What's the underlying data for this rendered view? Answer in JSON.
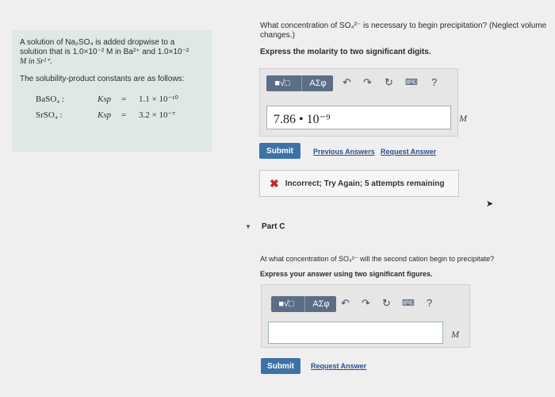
{
  "problem": {
    "intro_1": "A solution of Na₂SO₄ is added dropwise to a",
    "intro_2": "solution that is 1.0×10⁻² M in Ba²⁺ and 1.0×10⁻²",
    "intro_3": "M in Sr²⁺.",
    "ksp_title": "The solubility-product constants are as follows:",
    "ksp_rows": [
      {
        "compound": "BaSO₄ :",
        "symbol": "Ksp",
        "eq": "=",
        "value": "1.1 × 10⁻¹⁰"
      },
      {
        "compound": "SrSO₄ :",
        "symbol": "Ksp",
        "eq": "=",
        "value": "3.2 × 10⁻⁷"
      }
    ]
  },
  "part_b": {
    "question_1": "What concentration of SO₄²⁻ is necessary to begin precipitation? (Neglect volume",
    "question_2": "changes.)",
    "instruction": "Express the molarity to two significant digits.",
    "answer_value": "7.86 • 10⁻⁹",
    "unit": "M",
    "submit_label": "Submit",
    "previous_answers_label": "Previous Answers",
    "request_answer_label": "Request Answer",
    "feedback_icon": "x-icon",
    "feedback_text": "Incorrect; Try Again; 5 attempts remaining"
  },
  "toolbar": {
    "templates_icon": "templates-icon",
    "greek_label": "ΑΣφ",
    "undo_icon": "undo-icon",
    "redo_icon": "redo-icon",
    "reset_icon": "reset-icon",
    "keyboard_icon": "keyboard-icon",
    "help_label": "?"
  },
  "part_c": {
    "title": "Part C",
    "question": "At what concentration of SO₄²⁻ will the second cation begin to precipitate?",
    "instruction": "Express your answer using two significant figures.",
    "answer_value": "",
    "unit": "M",
    "submit_label": "Submit",
    "request_answer_label": "Request Answer"
  },
  "colors": {
    "panel_bg": "#dfe8e4",
    "toolbar_group": "#5b6e86",
    "submit_bg": "#3c72a7",
    "link": "#2a4f8c",
    "error": "#c0282d"
  }
}
